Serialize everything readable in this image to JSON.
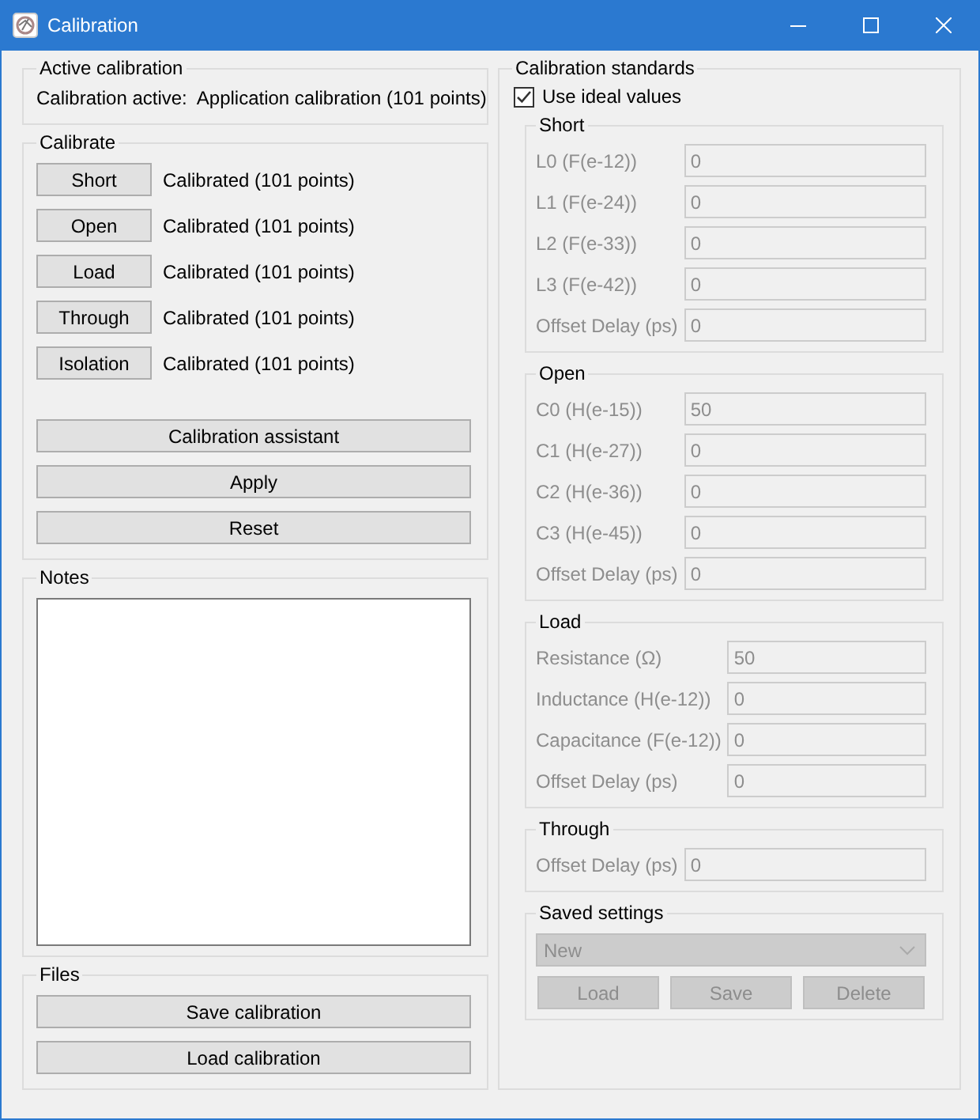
{
  "window": {
    "title": "Calibration"
  },
  "active_calibration": {
    "title": "Active calibration",
    "label": "Calibration active:",
    "value": "Application calibration (101 points)"
  },
  "calibrate": {
    "title": "Calibrate",
    "standards": [
      {
        "button": "Short",
        "status": "Calibrated (101 points)"
      },
      {
        "button": "Open",
        "status": "Calibrated (101 points)"
      },
      {
        "button": "Load",
        "status": "Calibrated (101 points)"
      },
      {
        "button": "Through",
        "status": "Calibrated (101 points)"
      },
      {
        "button": "Isolation",
        "status": "Calibrated (101 points)"
      }
    ],
    "buttons": [
      "Calibration assistant",
      "Apply",
      "Reset"
    ]
  },
  "notes": {
    "title": "Notes"
  },
  "files": {
    "title": "Files",
    "buttons": [
      "Save calibration",
      "Load calibration"
    ]
  },
  "standards": {
    "title": "Calibration standards",
    "use_ideal": {
      "label": "Use ideal values",
      "checked": true
    },
    "groups": [
      {
        "title": "Short",
        "fields": [
          {
            "label": "L0 (F(e-12))",
            "value": "0"
          },
          {
            "label": "L1 (F(e-24))",
            "value": "0"
          },
          {
            "label": "L2 (F(e-33))",
            "value": "0"
          },
          {
            "label": "L3 (F(e-42))",
            "value": "0"
          },
          {
            "label": "Offset Delay (ps)",
            "value": "0"
          }
        ]
      },
      {
        "title": "Open",
        "fields": [
          {
            "label": "C0 (H(e-15))",
            "value": "50"
          },
          {
            "label": "C1 (H(e-27))",
            "value": "0"
          },
          {
            "label": "C2 (H(e-36))",
            "value": "0"
          },
          {
            "label": "C3 (H(e-45))",
            "value": "0"
          },
          {
            "label": "Offset Delay (ps)",
            "value": "0"
          }
        ]
      },
      {
        "title": "Load",
        "fields": [
          {
            "label": "Resistance (Ω)",
            "value": "50"
          },
          {
            "label": "Inductance (H(e-12))",
            "value": "0"
          },
          {
            "label": "Capacitance (F(e-12))",
            "value": "0"
          },
          {
            "label": "Offset Delay (ps)",
            "value": "0"
          }
        ]
      },
      {
        "title": "Through",
        "fields": [
          {
            "label": "Offset Delay (ps)",
            "value": "0"
          }
        ]
      }
    ],
    "saved": {
      "title": "Saved settings",
      "selection": "New",
      "buttons": [
        "Load",
        "Save",
        "Delete"
      ]
    }
  }
}
